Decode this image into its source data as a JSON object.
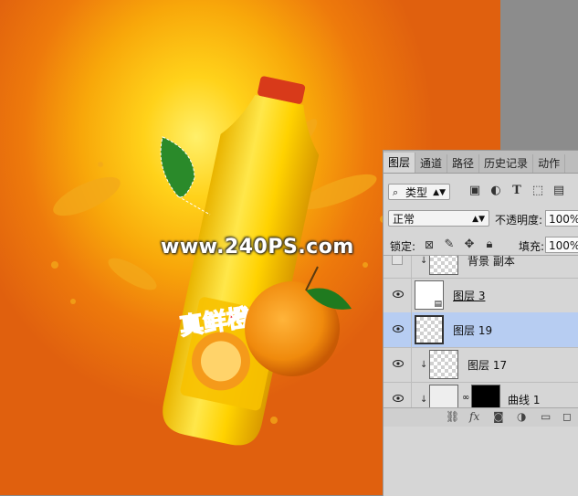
{
  "canvas": {
    "watermark": "www.240PS.com",
    "bottle_label": "真鲜橙"
  },
  "panel": {
    "tabs": [
      {
        "label": "图层",
        "active": true
      },
      {
        "label": "通道"
      },
      {
        "label": "路径"
      },
      {
        "label": "历史记录"
      },
      {
        "label": "动作"
      }
    ],
    "filter": {
      "icon": "search-icon",
      "label": "类型"
    },
    "blend_mode": "正常",
    "opacity_label": "不透明度:",
    "opacity_value": "100%",
    "lock_label": "锁定:",
    "fill_label": "填充:",
    "fill_value": "100%",
    "layers": [
      {
        "name": "背景 副本",
        "visible": false,
        "clipped": true
      },
      {
        "name": "图层 3",
        "visible": true,
        "clipped": false
      },
      {
        "name": "图层 19",
        "visible": true,
        "clipped": false,
        "selected": true
      },
      {
        "name": "图层 17",
        "visible": true,
        "clipped": true
      },
      {
        "name": "曲线 1",
        "visible": true,
        "clipped": true
      }
    ]
  }
}
